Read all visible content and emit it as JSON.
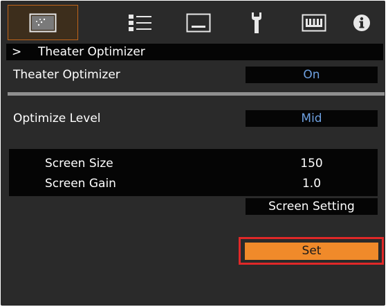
{
  "tabs": [
    {
      "icon": "picture-adjust-icon",
      "active": true
    },
    {
      "icon": "input-settings-icon",
      "active": false
    },
    {
      "icon": "display-icon",
      "active": false
    },
    {
      "icon": "wrench-icon",
      "active": false
    },
    {
      "icon": "network-icon",
      "active": false
    },
    {
      "icon": "info-icon",
      "active": false
    }
  ],
  "breadcrumb": {
    "arrow": ">",
    "title": "Theater Optimizer"
  },
  "rows": {
    "theater_optimizer": {
      "label": "Theater Optimizer",
      "value": "On"
    },
    "optimize_level": {
      "label": "Optimize Level",
      "value": "Mid"
    }
  },
  "screen_info": {
    "size_label": "Screen Size",
    "size_value": "150",
    "gain_label": "Screen Gain",
    "gain_value": "1.0"
  },
  "screen_setting_label": "Screen Setting",
  "set_label": "Set",
  "colors": {
    "background": "#2a2a2a",
    "active_tab": "#c0651a",
    "value_text": "#6ea0e0",
    "set_button": "#f08a2a",
    "highlight_outline": "#e02828"
  }
}
